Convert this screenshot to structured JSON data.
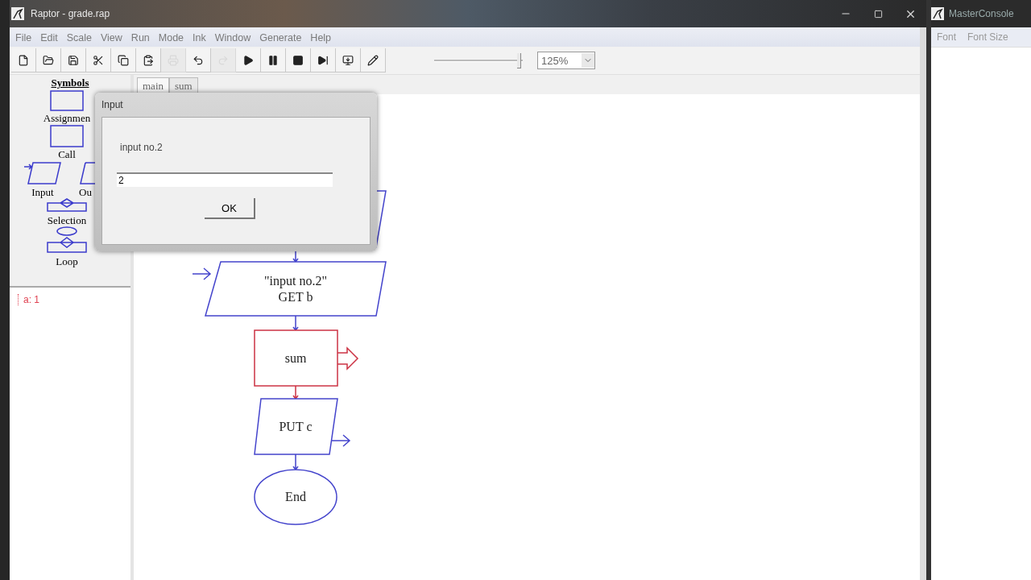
{
  "window": {
    "title": "Raptor - grade.rap"
  },
  "menu": [
    "File",
    "Edit",
    "Scale",
    "View",
    "Run",
    "Mode",
    "Ink",
    "Window",
    "Generate",
    "Help"
  ],
  "toolbar": [
    {
      "kind": "new",
      "disabled": false
    },
    {
      "kind": "open",
      "disabled": false
    },
    {
      "kind": "save",
      "disabled": false
    },
    {
      "kind": "cut",
      "disabled": false
    },
    {
      "kind": "copy",
      "disabled": false
    },
    {
      "kind": "paste",
      "disabled": false
    },
    {
      "kind": "print",
      "disabled": true
    },
    {
      "kind": "undo",
      "disabled": false
    },
    {
      "kind": "redo",
      "disabled": true
    },
    {
      "kind": "play",
      "disabled": false
    },
    {
      "kind": "pause",
      "disabled": false
    },
    {
      "kind": "stop",
      "disabled": false
    },
    {
      "kind": "step",
      "disabled": false
    },
    {
      "kind": "generate",
      "disabled": false
    },
    {
      "kind": "pen",
      "disabled": false
    }
  ],
  "speed_slider": {
    "level": 0.95
  },
  "zoom": {
    "value": "125%"
  },
  "symbols": {
    "title": "Symbols",
    "items": [
      {
        "kind": "assignment",
        "label": "Assignmen"
      },
      {
        "kind": "call",
        "label": "Call"
      },
      {
        "kind": "input",
        "label": "Input"
      },
      {
        "kind": "output",
        "label": "Ou"
      },
      {
        "kind": "selection",
        "label": "Selection"
      },
      {
        "kind": "loop",
        "label": "Loop"
      }
    ]
  },
  "variables": [
    "a: 1"
  ],
  "tabs": [
    {
      "label": "main",
      "selected": true
    },
    {
      "label": "sum",
      "selected": false
    }
  ],
  "flowchart": {
    "nodes": [
      {
        "kind": "input"
      },
      {
        "kind": "input",
        "lines": [
          "\"input no.2\"",
          "GET b"
        ]
      },
      {
        "kind": "call",
        "lines": [
          "sum"
        ],
        "active": true
      },
      {
        "kind": "output",
        "lines": [
          "PUT c"
        ]
      },
      {
        "kind": "end",
        "lines": [
          "End"
        ]
      }
    ]
  },
  "dialog": {
    "title": "Input",
    "prompt": "input no.2",
    "value": "2",
    "button": "OK"
  },
  "console": {
    "title": "MasterConsole",
    "menu": [
      "Font",
      "Font Size"
    ]
  }
}
